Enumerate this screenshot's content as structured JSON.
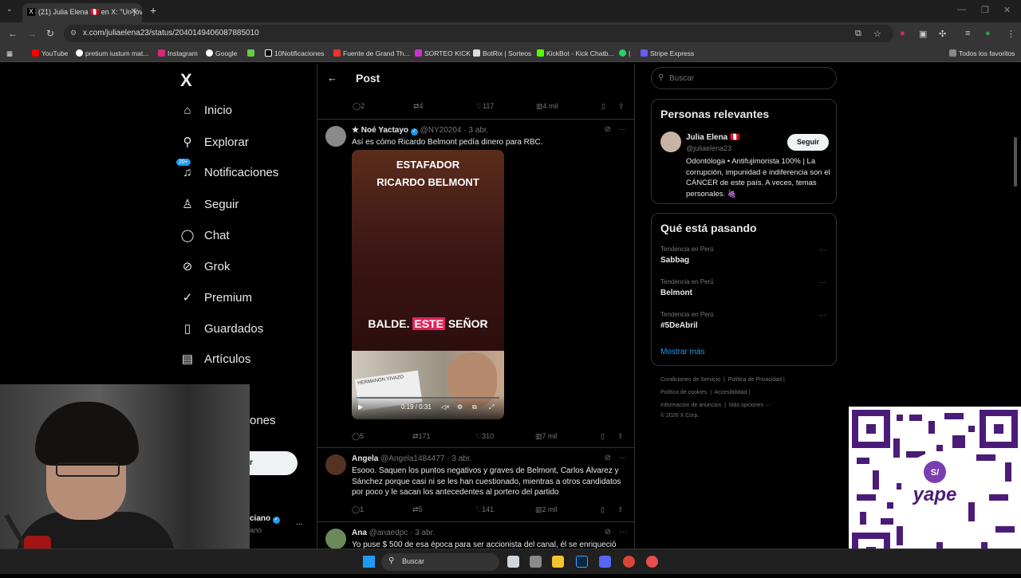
{
  "browser": {
    "tab_title": "(21) Julia Elena 🇵🇪 en X: \"Un jóv",
    "url": "x.com/juliaelena23/status/2040149406087885010",
    "bookmarks": [
      "YouTube",
      "pretium iustum mat...",
      "Instagram",
      "Google",
      "10Notificaciones",
      "Fuente de Grand Th...",
      "SORTEO KICK",
      "BotRix | Sorteos",
      "KickBot - Kick Chatb...",
      "|",
      "Stripe Express",
      "Todos los favoritos"
    ]
  },
  "sidebar": {
    "logo": "X",
    "items": [
      {
        "label": "Inicio",
        "icon": "home-icon",
        "glyph": "⌂"
      },
      {
        "label": "Explorar",
        "icon": "search-icon",
        "glyph": "⚲"
      },
      {
        "label": "Notificaciones",
        "icon": "bell-icon",
        "glyph": "♫",
        "badge": "20+"
      },
      {
        "label": "Seguir",
        "icon": "person-add-icon",
        "glyph": "♙"
      },
      {
        "label": "Chat",
        "icon": "chat-icon",
        "glyph": "◯"
      },
      {
        "label": "Grok",
        "icon": "grok-icon",
        "glyph": "⊘"
      },
      {
        "label": "Premium",
        "icon": "premium-icon",
        "glyph": "✓"
      },
      {
        "label": "Guardados",
        "icon": "bookmark-icon",
        "glyph": "▯"
      },
      {
        "label": "Artículos",
        "icon": "articles-icon",
        "glyph": "▤"
      }
    ],
    "partial_label": "ones",
    "partial_profile_name": "ciano",
    "partial_profile_handle": "ano",
    "more": "..."
  },
  "post_header": {
    "title": "Post",
    "back": "←"
  },
  "top_actions": {
    "replies": "2",
    "reposts": "4",
    "likes": "117",
    "views": "4 mil"
  },
  "tweets": [
    {
      "name": "★ Noé Yactayo",
      "handle": "@NY20204",
      "time": "· 3 abr.",
      "text": "Así es cómo Ricardo Belmont pedía dinero para RBC.",
      "video": {
        "top_text_1": "ESTAFADOR",
        "top_text_2": "RICARDO BELMONT",
        "mid_text_a": "BALDE.",
        "mid_text_b": "ESTE",
        "mid_text_c": "SEÑOR",
        "sign_text": "HERMANON VIVAZO",
        "progress": 0.02,
        "time": "0:19 / 0:31"
      },
      "actions": {
        "replies": "5",
        "reposts": "171",
        "likes": "310",
        "views": "7 mil"
      }
    },
    {
      "name": "Angela",
      "handle": "@Angela1484477",
      "time": "· 3 abr.",
      "text": "Esooo. Saquen los puntos negativos y graves de Belmont, Carlos Álvarez y Sánchez porque casi ni se les han cuestionado, mientras a otros candidatos por poco y le sacan los antecedentes al portero del partido",
      "actions": {
        "replies": "1",
        "reposts": "5",
        "likes": "141",
        "views": "2 mil"
      }
    },
    {
      "name": "Ana",
      "handle": "@anaedpc",
      "time": "· 3 abr.",
      "text": "Yo puse $ 500 de esa época para ser accionista del canal, él se enriqueció"
    }
  ],
  "right": {
    "search_placeholder": "Buscar",
    "relevant": {
      "title": "Personas relevantes",
      "name": "Julia Elena 🇵🇪",
      "handle": "@juliaelena23",
      "follow": "Seguir",
      "bio": "Odontóloga • Antifujimorista 100% | La corrupción, impunidad e indiferencia son el CÁNCER de este país. A veces, temas personales. 🍇"
    },
    "trends": {
      "title": "Qué está pasando",
      "items": [
        {
          "label": "Tendencia en Perú",
          "name": "Sabbag"
        },
        {
          "label": "Tendencia en Perú",
          "name": "Belmont"
        },
        {
          "label": "Tendencia en Perú",
          "name": "#5DeAbril"
        }
      ],
      "show_more": "Mostrar más"
    },
    "footer": [
      "Condiciones de Servicio",
      "Política de Privacidad",
      "Política de cookies",
      "Accesibilidad",
      "Información de anuncios",
      "Más opciones ···",
      "© 2026 X Corp."
    ]
  },
  "taskbar": {
    "search": "Buscar"
  },
  "colors": {
    "accent": "#1d9bf0",
    "bg": "#000000",
    "border": "#2f3336",
    "muted": "#71767b"
  }
}
